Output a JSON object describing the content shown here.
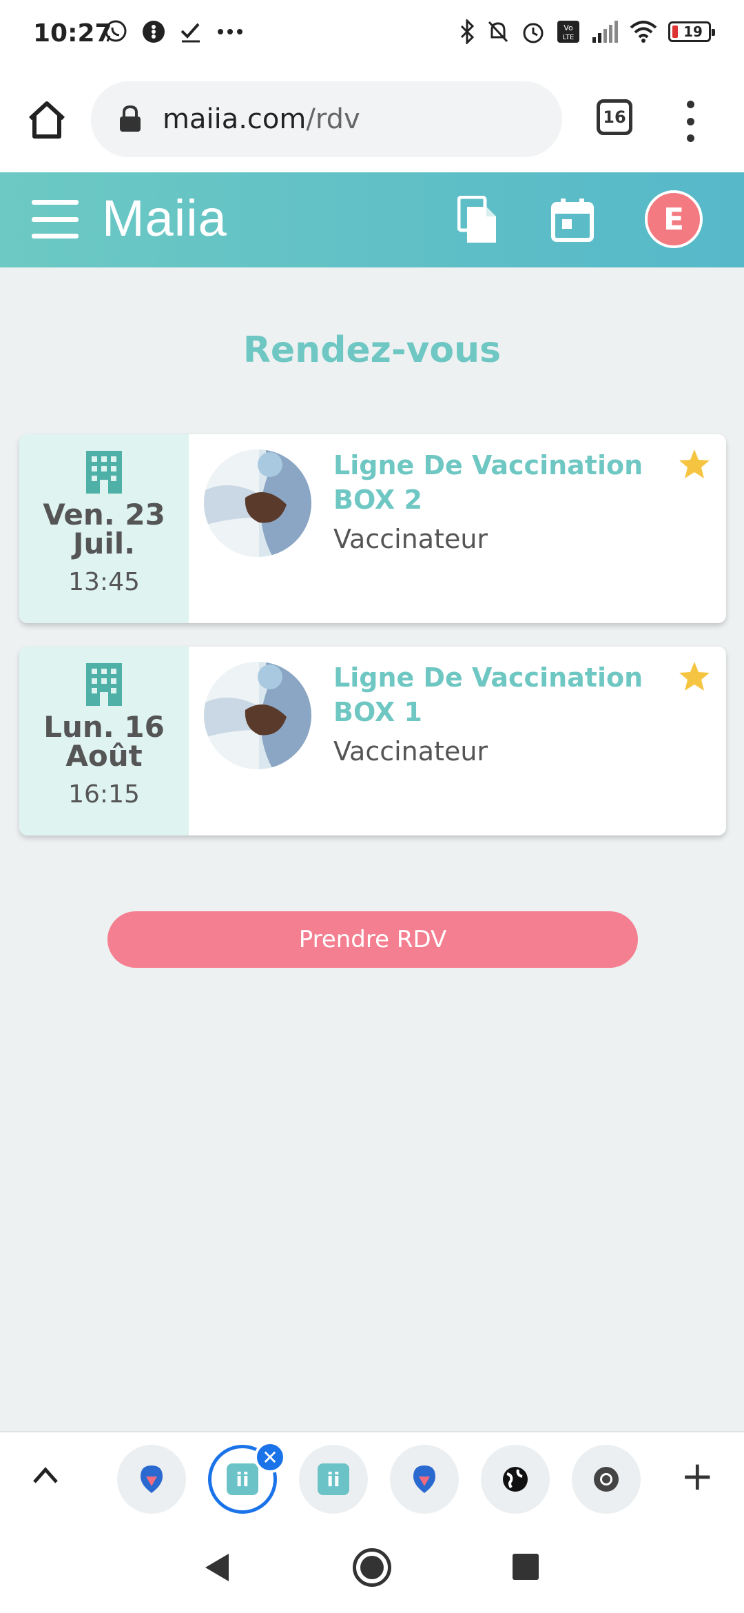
{
  "status_bar": {
    "time": "10:27",
    "battery": "19",
    "icons": [
      "whatsapp-icon",
      "notification-icon",
      "checkmark-icon",
      "more-icon",
      "bluetooth-icon",
      "mute-icon",
      "alarm-icon",
      "volte-icon",
      "signal-icon",
      "wifi-icon",
      "battery-icon"
    ]
  },
  "browser": {
    "url_host": "maiia.com",
    "url_path": "/rdv",
    "tab_count": "16"
  },
  "app_header": {
    "logo": "Maiia",
    "avatar_initial": "E",
    "colors": {
      "header_start": "#6cc9c3",
      "header_end": "#56b8c9",
      "avatar": "#f47a82"
    }
  },
  "page": {
    "title": "Rendez-vous",
    "appointments": [
      {
        "date": "Ven. 23 Juil.",
        "time": "13:45",
        "title": "Ligne De Vaccination BOX 2",
        "subtitle": "Vaccinateur",
        "favorite": true
      },
      {
        "date": "Lun. 16 Août",
        "time": "16:15",
        "title": "Ligne De Vaccination BOX 1",
        "subtitle": "Vaccinateur",
        "favorite": true
      }
    ],
    "cta_label": "Prendre RDV",
    "colors": {
      "accent": "#6ec7c2",
      "cta": "#f47f90",
      "star": "#f5c542"
    }
  },
  "tab_strip": {
    "tabs": [
      "doctolib-tab",
      "maiia-tab-active",
      "maiia-tab",
      "doctolib-tab",
      "globe-tab",
      "chrome-tab"
    ]
  }
}
